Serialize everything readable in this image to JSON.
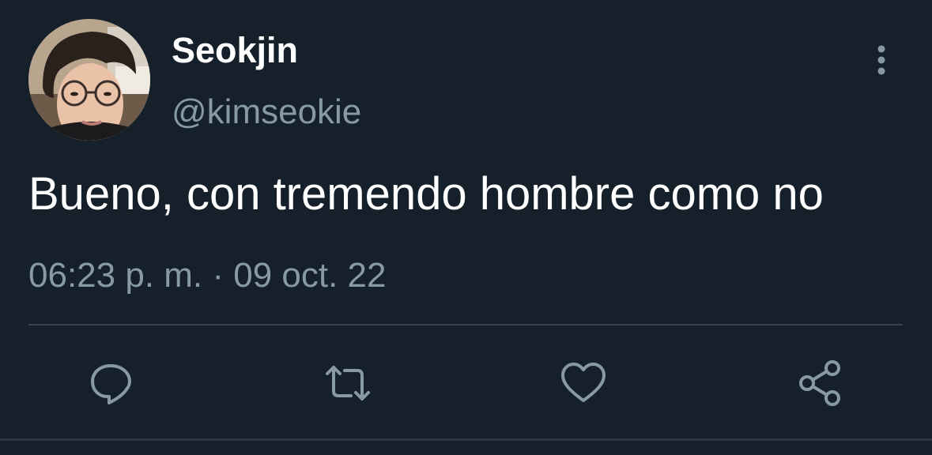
{
  "tweet": {
    "author": {
      "display_name": "Seokjin",
      "handle": "@kimseokie",
      "avatar_icon": "profile-photo"
    },
    "text": "Bueno, con tremendo hombre como no",
    "timestamp": "06:23 p. m. · 09 oct. 22",
    "more_icon": "vertical-ellipsis-icon"
  },
  "actions": [
    {
      "name": "reply",
      "icon": "speech-bubble-icon"
    },
    {
      "name": "retweet",
      "icon": "retweet-icon"
    },
    {
      "name": "like",
      "icon": "heart-icon"
    },
    {
      "name": "share",
      "icon": "share-nodes-icon"
    }
  ],
  "colors": {
    "background": "#15202b",
    "primary_text": "#ffffff",
    "secondary_text": "#8899a6",
    "divider": "#38444d",
    "icon": "#8899a6"
  }
}
